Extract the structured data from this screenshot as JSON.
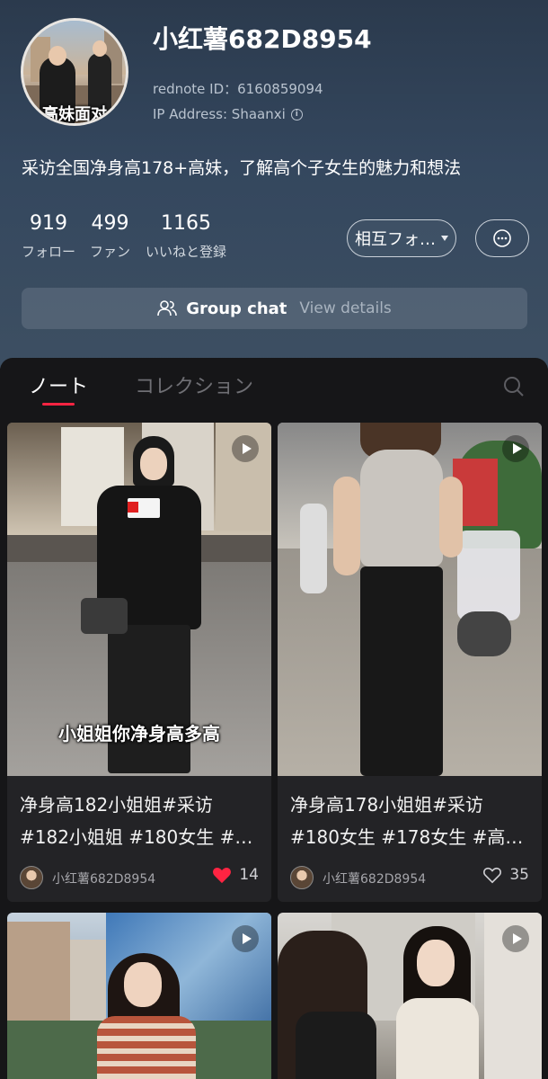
{
  "profile": {
    "avatar_caption": "高妹面对",
    "username": "小红薯682D8954",
    "rednote_id": "rednote ID：6160859094",
    "ip_address": "IP Address: Shaanxi",
    "bio": "采访全国净身高178+高妹，了解高个子女生的魅力和想法",
    "stats": [
      {
        "value": "919",
        "label": "フォロー"
      },
      {
        "value": "499",
        "label": "ファン"
      },
      {
        "value": "1165",
        "label": "いいねと登録"
      }
    ],
    "follow_button": "相互フォ…",
    "group_chat": {
      "title": "Group chat",
      "link": "View details"
    }
  },
  "tabs": {
    "active": "ノート",
    "inactive": "コレクション"
  },
  "notes": [
    {
      "overlay_text": "小姐姐你净身高多高",
      "title": "净身高182小姐姐#采访 #182小姐姐 #180女生 #…",
      "author": "小红薯682D8954",
      "likes": "14",
      "liked": true
    },
    {
      "title": "净身高178小姐姐#采访 #180女生 #178女生 #高…",
      "author": "小红薯682D8954",
      "likes": "35",
      "liked": false
    }
  ],
  "colors": {
    "accent": "#ff2442",
    "header_bg": "#34475e",
    "page_bg": "#161618",
    "card_bg": "#232326"
  },
  "icons": [
    "info-icon",
    "chevron-down-icon",
    "message-icon",
    "group-icon",
    "search-icon",
    "play-icon",
    "heart-icon"
  ]
}
